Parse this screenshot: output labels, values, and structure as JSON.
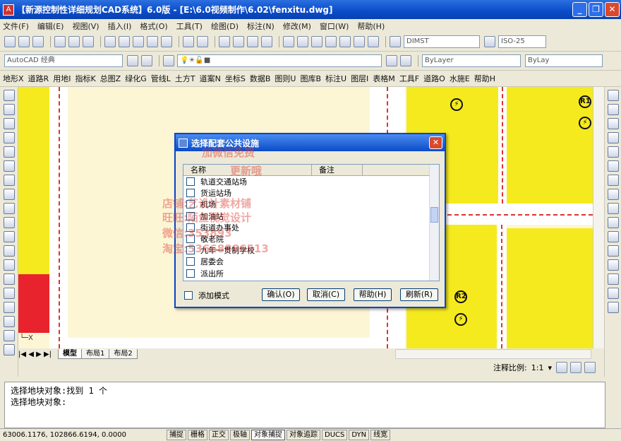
{
  "window": {
    "title": "【新源控制性详细规划CAD系统】6.0版 - [E:\\6.0视频制作\\6.02\\fenxitu.dwg]"
  },
  "menubar": [
    "文件(F)",
    "编辑(E)",
    "视图(V)",
    "插入(I)",
    "格式(O)",
    "工具(T)",
    "绘图(D)",
    "标注(N)",
    "修改(M)",
    "窗口(W)",
    "帮助(H)"
  ],
  "toolbar2": {
    "dimstyle": "DIMST",
    "textstyle": "ISO-25"
  },
  "toolbar3": {
    "workspace": "AutoCAD 经典",
    "layer_color": "ByLayer",
    "linetype": "ByLay"
  },
  "custom_menu": [
    "地形X",
    "道路R",
    "用地I",
    "指标K",
    "总图Z",
    "绿化G",
    "管线L",
    "土方T",
    "道案N",
    "坐标S",
    "数据B",
    "图则U",
    "图库B",
    "标注U",
    "图层I",
    "表格M",
    "工具F",
    "道路O",
    "水施E",
    "帮助H"
  ],
  "canvas_symbols": [
    "R1",
    "R2"
  ],
  "layout_tabs": [
    "模型",
    "布局1",
    "布局2"
  ],
  "annotation": {
    "label": "注释比例:",
    "scale": "1:1"
  },
  "command_lines": [
    "选择地块对象:找到 1 个",
    "选择地块对象:"
  ],
  "status": {
    "coords": "63006.1176, 102866.6194, 0.0000",
    "toggles": [
      {
        "label": "捕捉",
        "on": false
      },
      {
        "label": "栅格",
        "on": false
      },
      {
        "label": "正交",
        "on": false
      },
      {
        "label": "极轴",
        "on": false
      },
      {
        "label": "对象捕捉",
        "on": true
      },
      {
        "label": "对象追踪",
        "on": false
      },
      {
        "label": "DUCS",
        "on": false
      },
      {
        "label": "DYN",
        "on": false
      },
      {
        "label": "线宽",
        "on": false
      }
    ]
  },
  "dialog": {
    "title": "选择配套公共设施",
    "columns": [
      "名称",
      "备注"
    ],
    "items": [
      "轨道交通站场",
      "货运站场",
      "机场",
      "加油站",
      "街道办事处",
      "敬老院",
      "九年一贯制学校",
      "居委会",
      "派出所"
    ],
    "add_mode_label": "添加模式",
    "buttons": {
      "ok": "确认(O)",
      "cancel": "取消(C)",
      "help": "帮助(H)",
      "refresh": "刷新(R)"
    }
  },
  "watermark": [
    "加微信免费",
    "更新哦",
    "店铺:艺设计素材铺",
    "旺旺:陌鱼视觉设计",
    "微信:353893",
    "淘宝:53668886513"
  ]
}
